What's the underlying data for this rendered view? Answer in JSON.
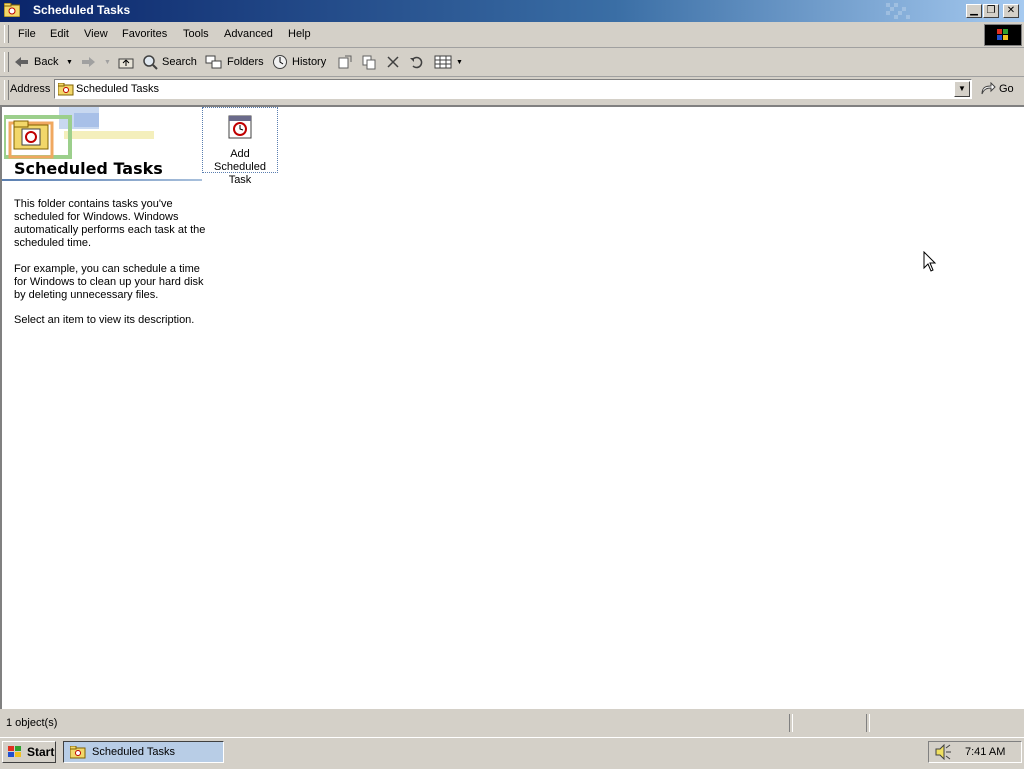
{
  "window": {
    "title": "Scheduled Tasks"
  },
  "menu": {
    "items": [
      "File",
      "Edit",
      "View",
      "Favorites",
      "Tools",
      "Advanced",
      "Help"
    ]
  },
  "toolbar": {
    "back_label": "Back",
    "search_label": "Search",
    "folders_label": "Folders",
    "history_label": "History"
  },
  "address": {
    "label": "Address",
    "value": "Scheduled Tasks",
    "go_label": "Go"
  },
  "pane": {
    "title": "Scheduled Tasks",
    "paragraphs": [
      "This folder contains tasks you've scheduled for Windows. Windows automatically performs each task at the scheduled time.",
      "For example, you can schedule a time for Windows to clean up your hard disk by deleting unnecessary files.",
      "Select an item to view its description."
    ]
  },
  "items": [
    {
      "label": "Add Scheduled Task",
      "icon": "scheduled-task-icon"
    }
  ],
  "status": {
    "text": "1 object(s)"
  },
  "taskbar": {
    "start_label": "Start",
    "window_button": "Scheduled Tasks",
    "clock": "7:41 AM"
  },
  "colors": {
    "title_start": "#0a246a",
    "title_end": "#a6caf0",
    "face": "#d4d0c8",
    "active_task": "#b8cde6"
  }
}
